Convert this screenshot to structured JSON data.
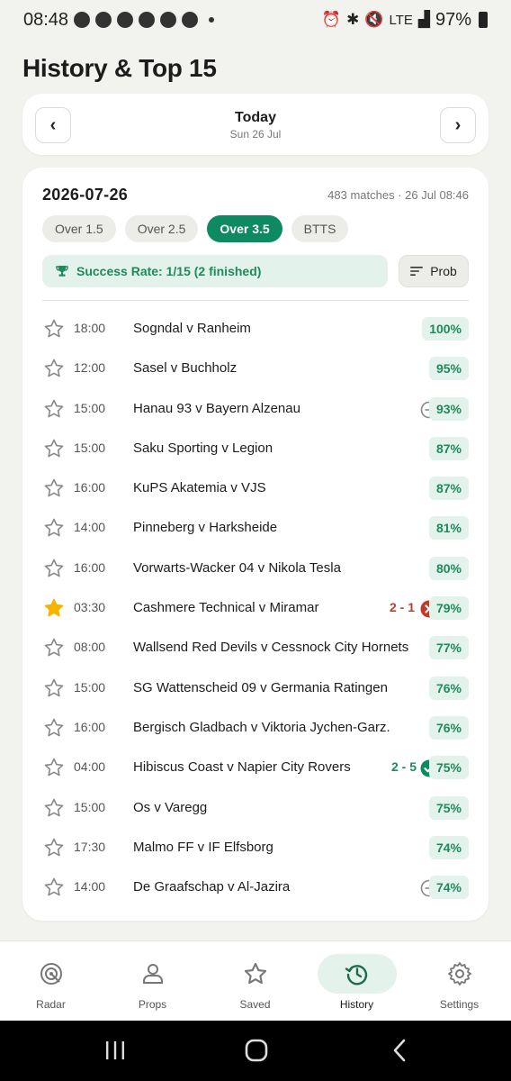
{
  "status_bar": {
    "time": "08:48",
    "network": "LTE",
    "battery": "97%"
  },
  "page_title": "History & Top 15",
  "date_nav": {
    "label": "Today",
    "sub": "Sun 26 Jul",
    "prev": "‹",
    "next": "›"
  },
  "summary": {
    "date": "2026-07-26",
    "meta": "483 matches · 26 Jul 08:46",
    "tabs": [
      "Over 1.5",
      "Over 2.5",
      "Over 3.5",
      "BTTS"
    ],
    "active_tab": "Over 3.5",
    "success_rate": "Success Rate: 1/15 (2 finished)",
    "sort_label": "Prob"
  },
  "matches": [
    {
      "time": "18:00",
      "name": "Sogndal v Ranheim",
      "pct": "100%",
      "starred": false,
      "status": "",
      "score": ""
    },
    {
      "time": "12:00",
      "name": "Sasel v Buchholz",
      "pct": "95%",
      "starred": false,
      "status": "",
      "score": ""
    },
    {
      "time": "15:00",
      "name": "Hanau 93 v Bayern Alzenau",
      "pct": "93%",
      "starred": false,
      "status": "void",
      "score": ""
    },
    {
      "time": "15:00",
      "name": "Saku Sporting v Legion",
      "pct": "87%",
      "starred": false,
      "status": "",
      "score": ""
    },
    {
      "time": "16:00",
      "name": "KuPS Akatemia v VJS",
      "pct": "87%",
      "starred": false,
      "status": "",
      "score": ""
    },
    {
      "time": "14:00",
      "name": "Pinneberg v Harksheide",
      "pct": "81%",
      "starred": false,
      "status": "",
      "score": ""
    },
    {
      "time": "16:00",
      "name": "Vorwarts-Wacker 04 v Nikola Tesla",
      "pct": "80%",
      "starred": false,
      "status": "",
      "score": ""
    },
    {
      "time": "03:30",
      "name": "Cashmere Technical v Miramar",
      "pct": "79%",
      "starred": true,
      "status": "loss",
      "score": "2 - 1"
    },
    {
      "time": "08:00",
      "name": "Wallsend Red Devils v Cessnock City Hornets",
      "pct": "77%",
      "starred": false,
      "status": "",
      "score": ""
    },
    {
      "time": "15:00",
      "name": "SG Wattenscheid 09 v Germania Ratingen",
      "pct": "76%",
      "starred": false,
      "status": "",
      "score": ""
    },
    {
      "time": "16:00",
      "name": "Bergisch Gladbach v Viktoria Jychen-Garz.",
      "pct": "76%",
      "starred": false,
      "status": "",
      "score": ""
    },
    {
      "time": "04:00",
      "name": "Hibiscus Coast v Napier City Rovers",
      "pct": "75%",
      "starred": false,
      "status": "win",
      "score": "2 - 5"
    },
    {
      "time": "15:00",
      "name": "Os v Varegg",
      "pct": "75%",
      "starred": false,
      "status": "",
      "score": ""
    },
    {
      "time": "17:30",
      "name": "Malmo FF v IF Elfsborg",
      "pct": "74%",
      "starred": false,
      "status": "",
      "score": ""
    },
    {
      "time": "14:00",
      "name": "De Graafschap v Al-Jazira",
      "pct": "74%",
      "starred": false,
      "status": "void",
      "score": ""
    }
  ],
  "bottom_nav": [
    {
      "label": "Radar",
      "icon": "radar-icon"
    },
    {
      "label": "Props",
      "icon": "person-icon"
    },
    {
      "label": "Saved",
      "icon": "star-icon"
    },
    {
      "label": "History",
      "icon": "history-icon"
    },
    {
      "label": "Settings",
      "icon": "gear-icon"
    }
  ],
  "active_nav": "History",
  "colors": {
    "accent": "#0e8a62",
    "success_bg": "#e3f2ea",
    "loss": "#c0392b",
    "star_active": "#f5b400"
  }
}
